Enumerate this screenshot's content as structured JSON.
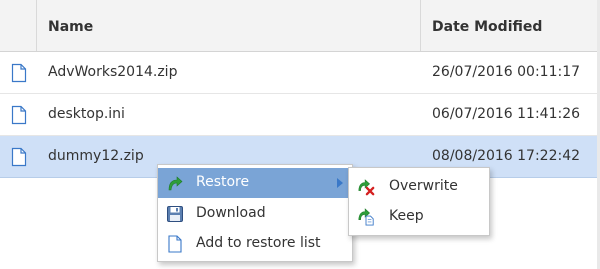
{
  "table": {
    "columns": {
      "name": "Name",
      "date_modified": "Date Modified"
    },
    "rows": [
      {
        "name": "AdvWorks2014.zip",
        "date": "26/07/2016 00:11:17",
        "selected": false
      },
      {
        "name": "desktop.ini",
        "date": "06/07/2016 11:41:26",
        "selected": false
      },
      {
        "name": "dummy12.zip",
        "date": "08/08/2016 17:22:42",
        "selected": true
      }
    ]
  },
  "context_menu": {
    "items": [
      {
        "label": "Restore",
        "icon": "restore-arrow-icon",
        "active": true,
        "has_submenu": true
      },
      {
        "label": "Download",
        "icon": "floppy-disk-icon"
      },
      {
        "label": "Add to restore list",
        "icon": "document-icon"
      }
    ]
  },
  "submenu": {
    "items": [
      {
        "label": "Overwrite",
        "icon": "overwrite-icon"
      },
      {
        "label": "Keep",
        "icon": "keep-icon"
      }
    ]
  },
  "colors": {
    "selected_row": "#cfe0f7",
    "menu_highlight": "#7aa4d6",
    "header_bg": "#f3f3f3",
    "icon_blue": "#3a78c8",
    "icon_green": "#2e9e3a",
    "icon_red": "#d42020"
  }
}
